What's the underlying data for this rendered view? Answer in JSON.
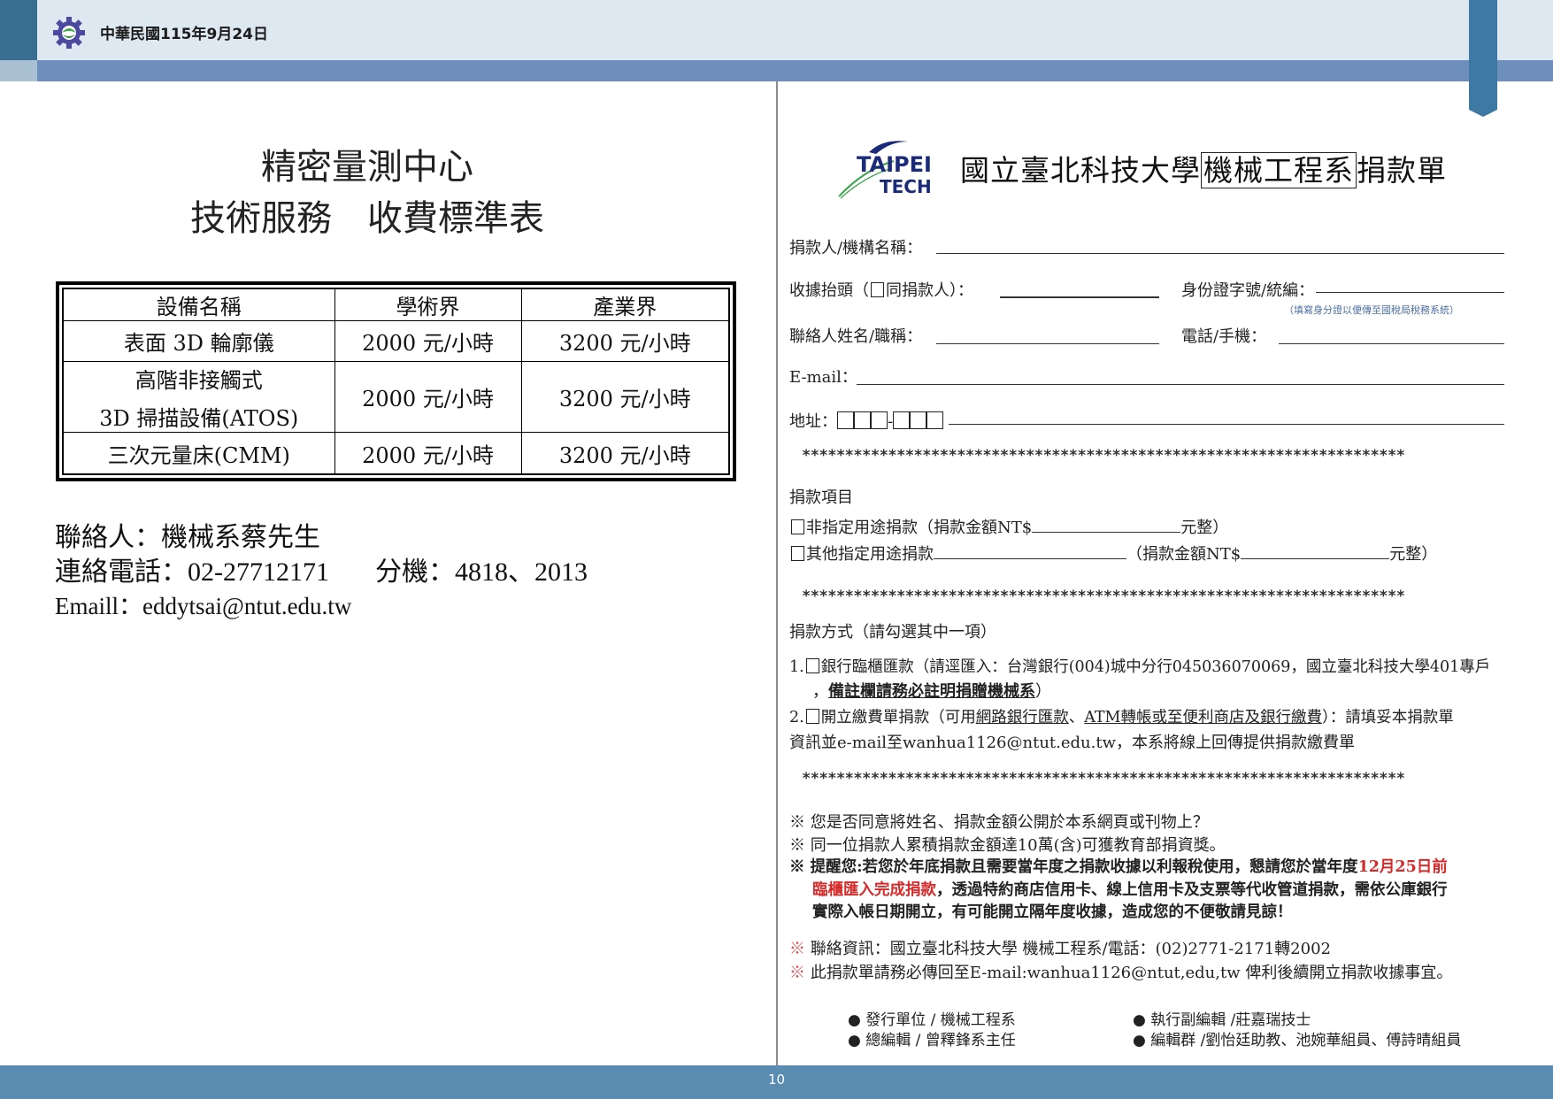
{
  "header": {
    "date": "中華民國115年9月24日",
    "logo_icon": "gear-leaf-logo-icon",
    "colors": {
      "top": "#dde8f1",
      "band": "#6e8fbc",
      "left_strip": "#3a6d92",
      "bookmark": "#3d79a3"
    }
  },
  "left_page": {
    "title_line1": "精密量測中心",
    "title_line2": "技術服務　收費標準表",
    "fee_table": {
      "headers": [
        "設備名稱",
        "學術界",
        "產業界"
      ],
      "rows": [
        {
          "equipment": "表面 3D 輪廓儀",
          "academic": "2000 元/小時",
          "industry": "3200 元/小時"
        },
        {
          "equipment_line1": "高階非接觸式",
          "equipment_line2": "3D 掃描設備(ATOS)",
          "academic": "2000 元/小時",
          "industry": "3200 元/小時"
        },
        {
          "equipment": "三次元量床(CMM)",
          "academic": "2000 元/小時",
          "industry": "3200 元/小時"
        }
      ]
    },
    "contact_person": "聯絡人：機械系蔡先生",
    "phone": "連絡電話：02-27712171",
    "extension": "分機：4818、2013",
    "email": "Emaill：eddytsai@ntut.edu.tw"
  },
  "right_page": {
    "logo_line1": "TAIPEI",
    "logo_line2": "TECH",
    "title_pre": "國立臺北科技大學",
    "title_boxed": "機械工程系",
    "title_post": "捐款單",
    "donor_label": "捐款人/機構名稱：",
    "receipt_label_pre": "收據抬頭（",
    "receipt_label_post": "同捐款人）：",
    "id_label": "身份證字號/統編：",
    "id_note": "（填寫身分證以便傳至國稅局稅務系統）",
    "contact_label": "聯絡人姓名/職稱：",
    "phone_label": "電話/手機：",
    "email_label": "E-mail：",
    "address_label": "地址：",
    "address_dash": "-",
    "stars": "**********************************************************************",
    "item_heading": "捐款項目",
    "item1_pre": "非指定用途捐款（捐款金額NT$",
    "item1_post": "元整）",
    "item2_pre": "其他指定用途捐款",
    "item2_mid": "（捐款金額NT$",
    "item2_post": "元整）",
    "method_heading": "捐款方式（請勾選其中一項）",
    "method1_num": "1.",
    "method1_text": "銀行臨櫃匯款（請逕匯入：台灣銀行(004)城中分行045036070069，國立臺北科技大學401專戶",
    "method1_note_pre": "，",
    "method1_note": "備註欄請務必註明捐贈機械系",
    "method1_note_post": "）",
    "method2_num": "2.",
    "method2_pre": "開立繳費單捐款（可用",
    "method2_u1": "網路銀行匯款",
    "method2_sep": "、",
    "method2_u2": "ATM轉帳或至便利商店及銀行繳費",
    "method2_post": "）：請填妥本捐款單",
    "method2_line2": "資訊並e-mail至wanhua1126@ntut.edu.tw，本系將線上回傳提供捐款繳費單",
    "note_mark": "※",
    "note1": "您是否同意將姓名、捐款金額公開於本系網頁或刊物上？",
    "note2": "同一位捐款人累積捐款金額達10萬(含)可獲教育部捐資獎。",
    "note3_pre": "提醒您:若您於年底捐款且需要當年度之捐款收據以利報稅使用，懇請您於當年度",
    "note3_red1": "12月25日前",
    "note3_red2": "臨櫃匯入完成捐款",
    "note3_line2_post": "，透過特約商店信用卡、線上信用卡及支票等代收管道捐款，需依公庫銀行",
    "note3_line3": "實際入帳日期開立，有可能開立隔年度收據，造成您的不便敬請見諒！",
    "contact_info": "聯絡資訊：國立臺北科技大學 機械工程系/電話：(02)2771-2171轉2002",
    "return_info": "此捐款單請務必傳回至E-mail:wanhua1126@ntut,edu,tw 俾利後續開立捐款收據事宜。"
  },
  "credits": {
    "issuer": "● 發行單位 / 機械工程系",
    "editor": "● 總編輯 / 曾釋鋒系主任",
    "exec_editor": "● 執行副編輯 /莊嘉瑞技士",
    "editors": "● 編輯群 /劉怡廷助教、池婉華組員、傅詩晴組員"
  },
  "footer": {
    "page_number": "10"
  }
}
